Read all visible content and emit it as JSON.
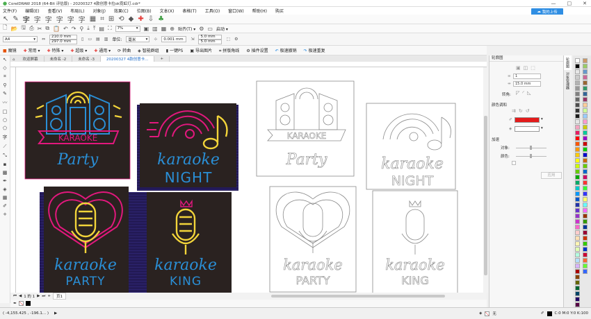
{
  "title": "CorelDRAW 2018 (64-Bit 评估版) - 20200327 4款创意卡拉ok霓虹灯.cdr*",
  "menu": [
    "文件(F)",
    "编辑(E)",
    "查看(V)",
    "布局(L)",
    "对象(J)",
    "效果(C)",
    "位图(B)",
    "文本(X)",
    "表格(T)",
    "工具(O)",
    "窗口(W)",
    "帮助(H)",
    "购买"
  ],
  "cloud_button": "我的上传",
  "toolbar": {
    "zoom": "7%",
    "snap_label": "贴齐(T)",
    "launch_label": "启动"
  },
  "propbar": {
    "page_size": "A4",
    "width": "210.0 mm",
    "height": "297.0 mm",
    "units_label": "单位:",
    "units": "毫米",
    "nudge": "0.001 mm",
    "dup_x": "5.0 mm",
    "dup_y": "5.0 mm"
  },
  "plugins": [
    "魔镜",
    "常用",
    "特殊",
    "超级",
    "通用",
    "转曲",
    "智能群组",
    "一键PS",
    "导出图片",
    "拼版角线",
    "插件设置",
    "极速撤销",
    "极速重复"
  ],
  "tabs": [
    "欢迎屏幕",
    "未命名 -2",
    "未命名 -3",
    "20200327 4款创意卡..."
  ],
  "active_tab": 3,
  "artwork": {
    "party1": "KARAOKE",
    "party2": "Party",
    "night1": "karaoke",
    "night2": "NIGHT",
    "heart1": "karaoke",
    "heart2": "PARTY",
    "king1": "karaoke",
    "king2": "KING"
  },
  "colors": {
    "neon_yellow": "#f2d43a",
    "neon_pink": "#e2187d",
    "neon_blue": "#2a8fd6",
    "dark_bg": "#2a2220",
    "navy": "#231a56",
    "outline": "#8a8a8a",
    "accent": "#2f8ee3"
  },
  "page_nav": {
    "current": "1 的 1",
    "page_label": "页1"
  },
  "docker": {
    "title": "轮廓图",
    "steps": "1",
    "offset": "15.0 mm",
    "corner_label": "转角:",
    "color_section": "颜色调和",
    "accel_section": "加速",
    "object_label": "对象:",
    "color_label": "颜色:",
    "apply_label": "应用",
    "tabs": [
      "轮廓图",
      "对象管理器"
    ]
  },
  "status": {
    "coords": "( -4,155.425 , -196.1... )",
    "fill": "无",
    "color_info": "C:0 M:0 Y:0 K:100"
  },
  "palette_colors": [
    "#ffffff",
    "#000000",
    "#e6e6e6",
    "#cccccc",
    "#b3b3b3",
    "#999999",
    "#808080",
    "#666666",
    "#4d4d4d",
    "#333333",
    "#1a1a1a",
    "#e6e6e6",
    "#f4a3c0",
    "#e91e63",
    "#ff0000",
    "#ff5500",
    "#ff9900",
    "#ffcc00",
    "#ffff00",
    "#ccff00",
    "#66cc00",
    "#00aa00",
    "#00aa66",
    "#00cccc",
    "#0099ff",
    "#0055cc",
    "#2233aa",
    "#6633cc",
    "#9933cc",
    "#cc33cc",
    "#ff66cc",
    "#ffcccc",
    "#ffe0b3",
    "#fff5b3",
    "#e0ffb3",
    "#b3ffe0",
    "#b3e0ff",
    "#d9b3ff",
    "#aa0000",
    "#884400",
    "#666600",
    "#006633",
    "#004466",
    "#220066",
    "#550044",
    "#cc9966",
    "#99cc66",
    "#6699cc",
    "#cc6699",
    "#996633",
    "#339966",
    "#336699",
    "#993366",
    "#ffcc99",
    "#ccff99",
    "#99ccff",
    "#ff99cc",
    "#cccc00",
    "#00cc99",
    "#9900cc",
    "#cc0000",
    "#00cc00",
    "#0000cc",
    "#cc6600",
    "#66cc00",
    "#0066cc",
    "#cc0066",
    "#ff3333",
    "#33ff33",
    "#3333ff",
    "#ffff66",
    "#66ffff",
    "#ff66ff",
    "#993300",
    "#339900",
    "#003399",
    "#990033",
    "#cc3300",
    "#33cc00",
    "#0033cc",
    "#cc0033",
    "#ff6633",
    "#66ff33",
    "#3366ff"
  ]
}
